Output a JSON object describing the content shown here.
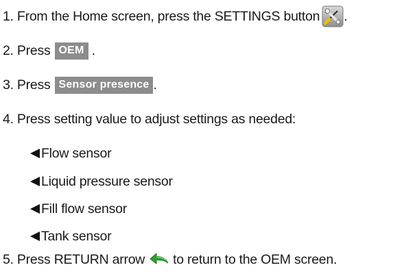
{
  "steps": [
    {
      "text": "1. From the Home screen, press the SETTINGS button",
      "icon": "settings-tools-icon",
      "after": "."
    },
    {
      "text": "2. Press",
      "button": "OEM",
      "after": "."
    },
    {
      "text": "3. Press",
      "button": "Sensor presence",
      "after": "."
    },
    {
      "text": "4. Press setting value to adjust settings as needed:"
    },
    {
      "text": "5. Press RETURN arrow",
      "icon": "return-arrow-icon",
      "after": "to return to the OEM screen."
    }
  ],
  "settings_list": [
    "Flow sensor",
    "Liquid pressure sensor",
    "Fill flow sensor",
    "Tank sensor"
  ],
  "colors": {
    "button_bg": "#8c8c8c",
    "button_text": "#ffffff",
    "return_arrow": "#2aa02a",
    "tools_icon_bg": "#b9b9b9"
  }
}
